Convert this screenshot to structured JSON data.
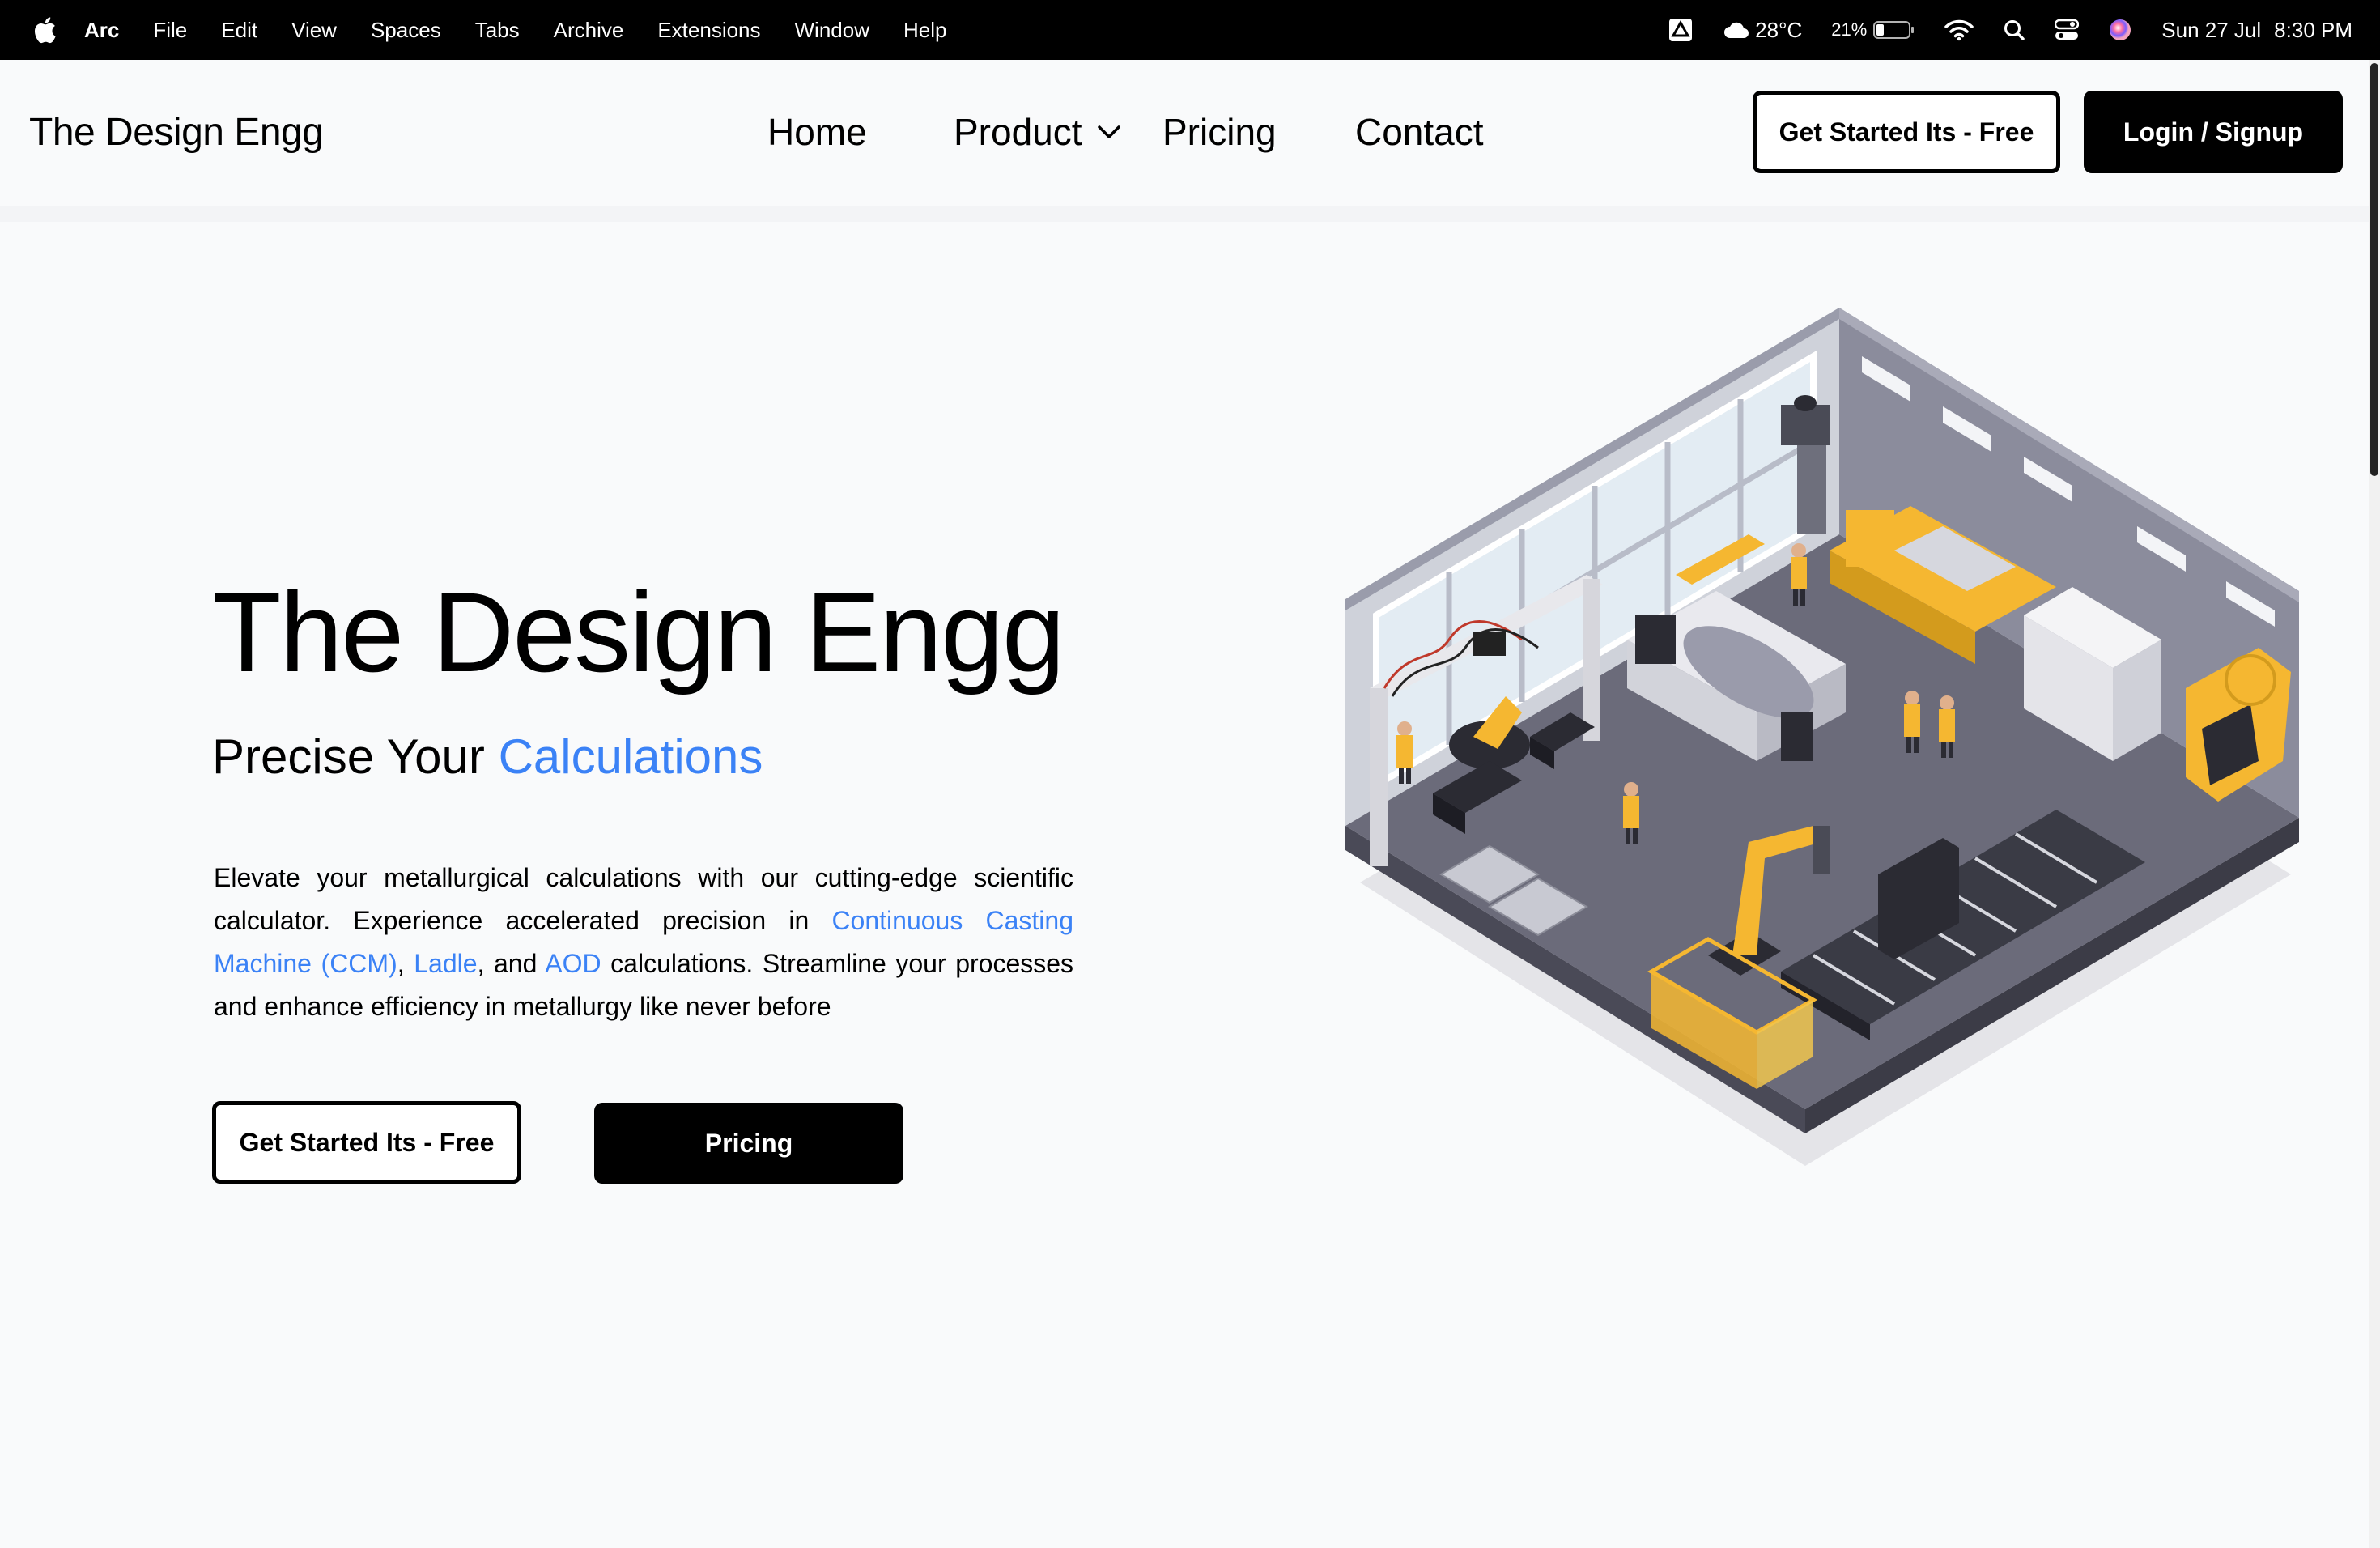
{
  "menubar": {
    "app_name": "Arc",
    "items": [
      "File",
      "Edit",
      "View",
      "Spaces",
      "Tabs",
      "Archive",
      "Extensions",
      "Window",
      "Help"
    ],
    "weather": "28°C",
    "battery": "21%",
    "date": "Sun 27 Jul",
    "time": "8:30 PM"
  },
  "navbar": {
    "brand": "The Design Engg",
    "links": {
      "home": "Home",
      "product": "Product",
      "pricing": "Pricing",
      "contact": "Contact"
    },
    "get_started": "Get Started Its - Free",
    "login": "Login / Signup"
  },
  "hero": {
    "title": "The Design Engg",
    "subtitle_prefix": "Precise Your",
    "subtitle_accent": "Calculations",
    "text_1": "Elevate your metallurgical calculations with our cutting-edge scientific calculator. Experience accelerated precision in",
    "link_ccm": "Continuous Casting Machine (CCM)",
    "sep_1": ",",
    "link_ladle": "Ladle",
    "sep_2": ", and",
    "link_aod": "AOD",
    "text_2": "calculations. Streamline your processes and enhance efficiency in metallurgy like never before",
    "get_started": "Get Started Its - Free",
    "pricing": "Pricing"
  },
  "colors": {
    "accent": "#3b82f6",
    "primary": "#000000",
    "background": "#f9fafb",
    "factory_yellow": "#f5b731",
    "factory_floor": "#6b6b7a"
  },
  "icons": [
    "apple-icon",
    "drive-icon",
    "cloud-icon",
    "battery-icon",
    "wifi-icon",
    "search-icon",
    "control-center-icon",
    "siri-icon",
    "chevron-down-icon"
  ]
}
